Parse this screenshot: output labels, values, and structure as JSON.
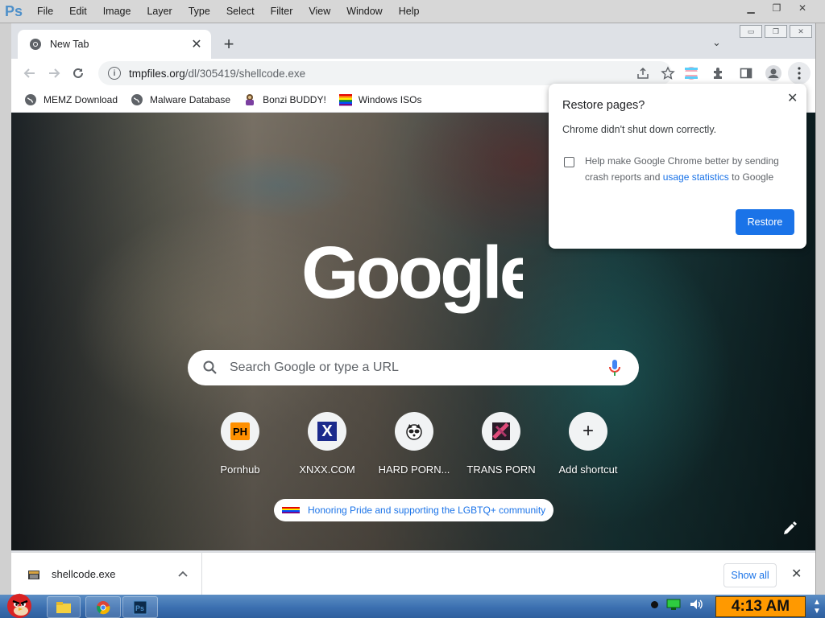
{
  "photoshop": {
    "logo": "Ps",
    "menu": [
      "File",
      "Edit",
      "Image",
      "Layer",
      "Type",
      "Select",
      "Filter",
      "View",
      "Window",
      "Help"
    ]
  },
  "chrome": {
    "tab": {
      "title": "New Tab"
    },
    "omnibox": {
      "domain": "tmpfiles.org",
      "path": "/dl/305419/shellcode.exe"
    },
    "bookmarks": [
      "MEMZ Download",
      "Malware Database",
      "Bonzi BUDDY!",
      "Windows ISOs"
    ]
  },
  "ntp": {
    "search_placeholder": "Search Google or type a URL",
    "shortcuts": [
      {
        "label": "Pornhub",
        "icon": "pornhub-icon",
        "glyph": "PH"
      },
      {
        "label": "XNXX.COM",
        "icon": "xnxx-icon",
        "glyph": "X"
      },
      {
        "label": "HARD PORN...",
        "icon": "raccoon-icon",
        "glyph": ""
      },
      {
        "label": "TRANS PORN",
        "icon": "trans-porn-icon",
        "glyph": ""
      },
      {
        "label": "Add shortcut",
        "icon": "add-icon",
        "glyph": "+"
      }
    ],
    "pride_text": "Honoring Pride and supporting the LGBTQ+ community"
  },
  "restore_popup": {
    "title": "Restore pages?",
    "message": "Chrome didn't shut down correctly.",
    "crash_text_1": "Help make Google Chrome better by sending crash reports and ",
    "crash_link": "usage statistics",
    "crash_text_2": " to Google",
    "button": "Restore"
  },
  "download_bar": {
    "filename": "shellcode.exe",
    "show_all": "Show all"
  },
  "taskbar": {
    "clock": "4:13 AM"
  },
  "colors": {
    "chrome_blue": "#1a73e8",
    "clock_orange": "#ff9900",
    "taskbar_blue": "#3b6fb0"
  }
}
